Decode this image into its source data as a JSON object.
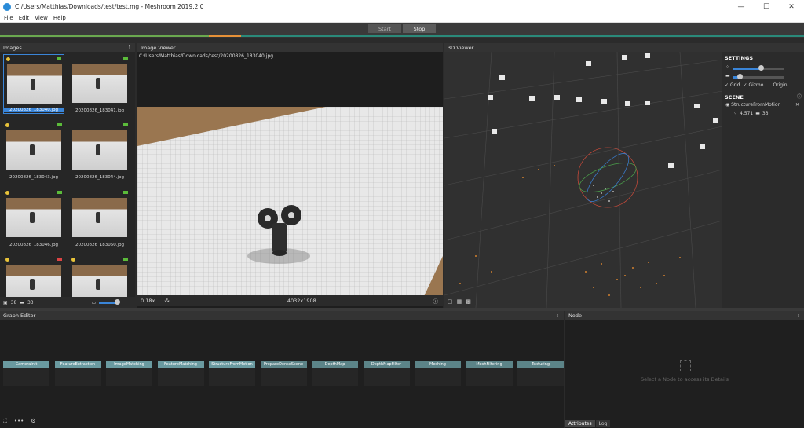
{
  "window": {
    "title": "C:/Users/Matthias/Downloads/test/test.mg - Meshroom 2019.2.0",
    "minimize": "—",
    "maximize": "☐",
    "close": "✕"
  },
  "menu": [
    "File",
    "Edit",
    "View",
    "Help"
  ],
  "toolbar": {
    "start_label": "Start",
    "stop_label": "Stop"
  },
  "progress": {
    "done_color": "#6aa84f",
    "running_color": "#e69138",
    "pending_color": "#2a8a7a",
    "done_fraction": 0.26,
    "running_fraction": 0.04
  },
  "images": {
    "header": "Images",
    "items": [
      {
        "label": "20200826_183040.jpg"
      },
      {
        "label": "20200826_183041.jpg"
      },
      {
        "label": "20200826_183043.jpg"
      },
      {
        "label": "20200826_183044.jpg"
      },
      {
        "label": "20200826_183046.jpg"
      },
      {
        "label": "20200826_183050.jpg"
      },
      {
        "label": ""
      },
      {
        "label": ""
      }
    ],
    "count_images": "38",
    "count_cameras": "33"
  },
  "image_viewer": {
    "header": "Image Viewer",
    "path": "C:/Users/Matthias/Downloads/test/20200826_183040.jpg",
    "zoom": "0.18x",
    "resolution": "4032x1908"
  },
  "viewer3d": {
    "header": "3D Viewer"
  },
  "settings": {
    "header": "SETTINGS",
    "grid_label": "Grid",
    "gizmo_label": "Gizmo",
    "origin_label": "Origin",
    "scene_header": "SCENE",
    "scene_item": "StructureFromMotion",
    "points": "4,571",
    "cameras": "33",
    "slider1_value": 0.55,
    "slider2_value": 0.12
  },
  "graph": {
    "header": "Graph Editor",
    "nodes": [
      {
        "label": "CameraInit",
        "done": true
      },
      {
        "label": "FeatureExtraction",
        "done": true
      },
      {
        "label": "ImageMatching",
        "done": true
      },
      {
        "label": "FeatureMatching",
        "done": true
      },
      {
        "label": "StructureFromMotion",
        "done": true
      },
      {
        "label": "PrepareDenseScene",
        "done": false
      },
      {
        "label": "DepthMap",
        "done": false
      },
      {
        "label": "DepthMapFilter",
        "done": false
      },
      {
        "label": "Meshing",
        "done": false
      },
      {
        "label": "MeshFiltering",
        "done": false
      },
      {
        "label": "Texturing",
        "done": false
      }
    ]
  },
  "node_panel": {
    "header": "Node",
    "empty": "Select a Node to access its Details",
    "tab_attributes": "Attributes",
    "tab_log": "Log"
  }
}
